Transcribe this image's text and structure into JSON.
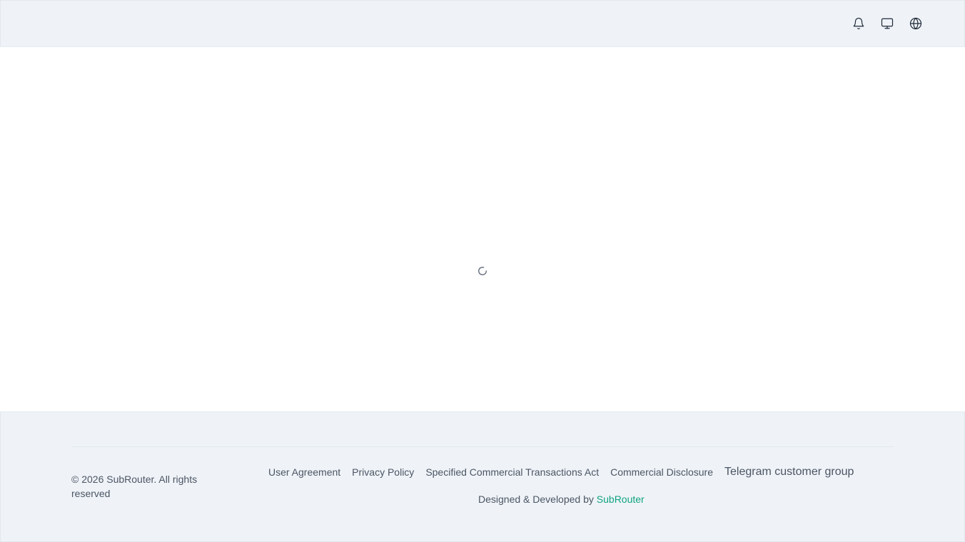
{
  "header": {
    "icons": [
      "bell-icon",
      "monitor-icon",
      "globe-icon"
    ]
  },
  "main": {
    "state": "loading"
  },
  "footer": {
    "copyright": "© 2026 SubRouter. All rights reserved",
    "links": [
      "User Agreement",
      "Privacy Policy",
      "Specified Commercial Transactions Act",
      "Commercial Disclosure",
      "Telegram customer group"
    ],
    "credit_prefix": "Designed & Developed by",
    "credit_brand": "SubRouter",
    "brand_color": "#10a37f"
  }
}
